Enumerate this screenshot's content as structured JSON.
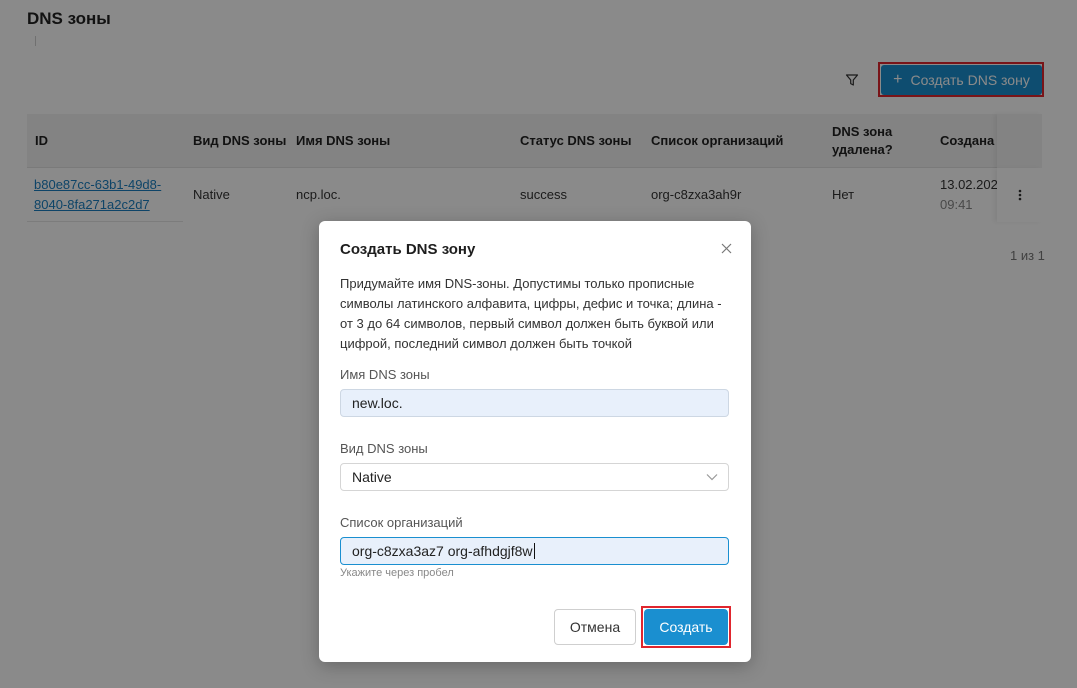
{
  "page": {
    "title": "DNS зоны",
    "create_button_label": "Создать DNS зону",
    "pagination": "1 из 1"
  },
  "table": {
    "columns": [
      "ID",
      "Вид DNS зоны",
      "Имя DNS зоны",
      "Статус DNS зоны",
      "Список организаций",
      "DNS зона\nудалена?",
      "Создана"
    ],
    "rows": [
      {
        "id": "b80e87cc-63b1-49d8-8040-8fa271a2c2d7",
        "type": "Native",
        "name": "ncp.loc.",
        "status": "success",
        "orgs": "org-c8zxa3ah9r",
        "deleted": "Нет",
        "created_date": "13.02.202",
        "created_time": "09:41"
      }
    ]
  },
  "modal": {
    "title": "Создать DNS зону",
    "description": "Придумайте имя DNS-зоны. Допустимы только прописные символы латинского алфавита, цифры, дефис и точка; длина - от 3 до 64 символов, первый символ должен быть буквой или цифрой, последний символ должен быть точкой",
    "name_label": "Имя DNS зоны",
    "name_value": "new.loc.",
    "type_label": "Вид DNS зоны",
    "type_value": "Native",
    "orgs_label": "Список организаций",
    "orgs_value": "org-c8zxa3az7 org-afhdgjf8w",
    "orgs_hint": "Укажите через пробел",
    "cancel_label": "Отмена",
    "submit_label": "Создать"
  },
  "colors": {
    "accent": "#1a8fd0",
    "highlight": "#e0262e",
    "overlay": "rgba(0,0,0,0.46)"
  }
}
